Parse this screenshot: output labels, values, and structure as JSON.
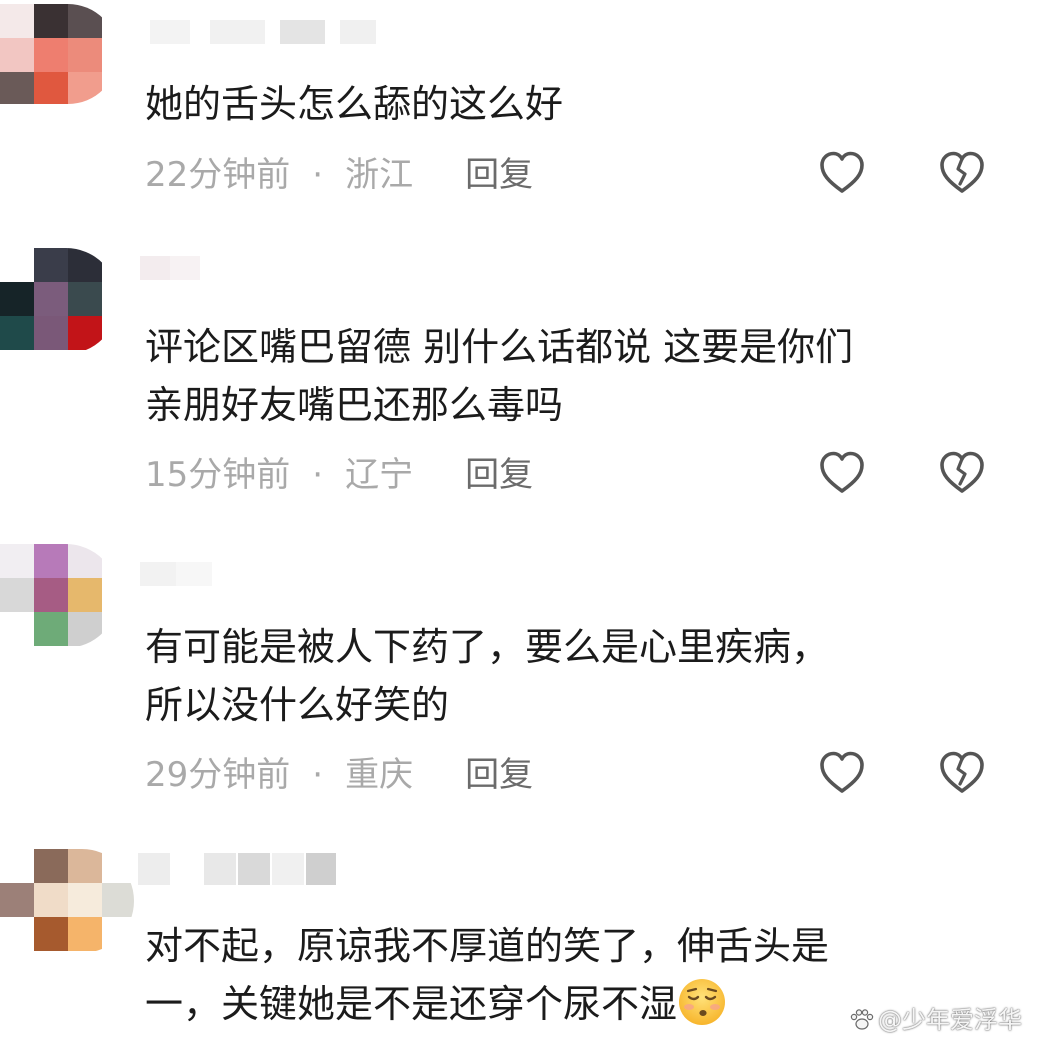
{
  "comments": [
    {
      "text": "她的舌头怎么舔的这么好",
      "time": "22分钟前",
      "separator": "·",
      "location": "浙江",
      "reply_label": "回复"
    },
    {
      "text": "评论区嘴巴留德 别什么话都说 这要是你们\n亲朋好友嘴巴还那么毒吗",
      "time": "15分钟前",
      "separator": "·",
      "location": "辽宁",
      "reply_label": "回复"
    },
    {
      "text": "有可能是被人下药了，要么是心里疾病，\n所以没什么好笑的",
      "time": "29分钟前",
      "separator": "·",
      "location": "重庆",
      "reply_label": "回复"
    },
    {
      "text": "对不起，原谅我不厚道的笑了，伸舌头是\n一，关键她是不是还穿个尿不湿",
      "emoji": "pensive-face-emoji"
    }
  ],
  "watermark": "@少年爱浮华",
  "icons": {
    "like": "heart-outline-icon",
    "dislike": "broken-heart-icon",
    "watermark_logo": "paw-logo-icon"
  },
  "colors": {
    "meta_text": "#a9a9a9",
    "reply_text": "#6b6b6b",
    "icon_stroke": "#555555",
    "comment_text": "#1b1b1b"
  }
}
